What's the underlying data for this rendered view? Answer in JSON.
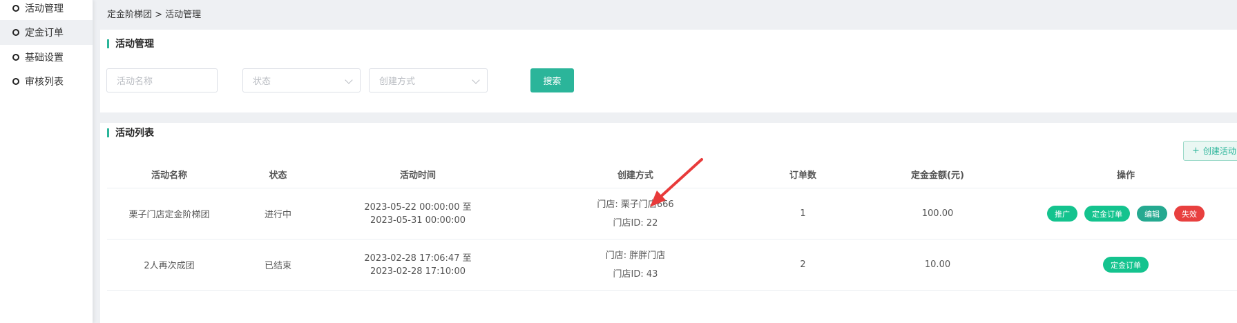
{
  "sidebar": {
    "items": [
      {
        "label": "活动管理",
        "active": false
      },
      {
        "label": "定金订单",
        "active": true
      },
      {
        "label": "基础设置",
        "active": false
      },
      {
        "label": "审核列表",
        "active": false
      }
    ]
  },
  "breadcrumb": "定金阶梯团 > 活动管理",
  "search_panel": {
    "title": "活动管理",
    "name_placeholder": "活动名称",
    "status_placeholder": "状态",
    "method_placeholder": "创建方式",
    "search_label": "搜索"
  },
  "list_panel": {
    "title": "活动列表",
    "create_label": "创建活动",
    "columns": [
      "活动名称",
      "状态",
      "活动时间",
      "创建方式",
      "订单数",
      "定金金额(元)",
      "操作"
    ],
    "rows": [
      {
        "name": "栗子门店定金阶梯团",
        "status": "进行中",
        "time_start": "2023-05-22 00:00:00 至",
        "time_end": "2023-05-31 00:00:00",
        "store": "门店: 栗子门店666",
        "store_id": "门店ID: 22",
        "orders": "1",
        "amount": "100.00",
        "actions": [
          "推广",
          "定金订单",
          "编辑",
          "失效"
        ]
      },
      {
        "name": "2人再次成团",
        "status": "已结束",
        "time_start": "2023-02-28 17:06:47 至",
        "time_end": "2023-02-28 17:10:00",
        "store": "门店: 胖胖门店",
        "store_id": "门店ID: 43",
        "orders": "2",
        "amount": "10.00",
        "actions": [
          "定金订单"
        ]
      }
    ]
  },
  "colors": {
    "accent": "#2bb59a",
    "action_green": "#14c38e",
    "action_teal": "#25a990",
    "action_red": "#e8403f",
    "annotation_arrow": "#e83a3a"
  }
}
